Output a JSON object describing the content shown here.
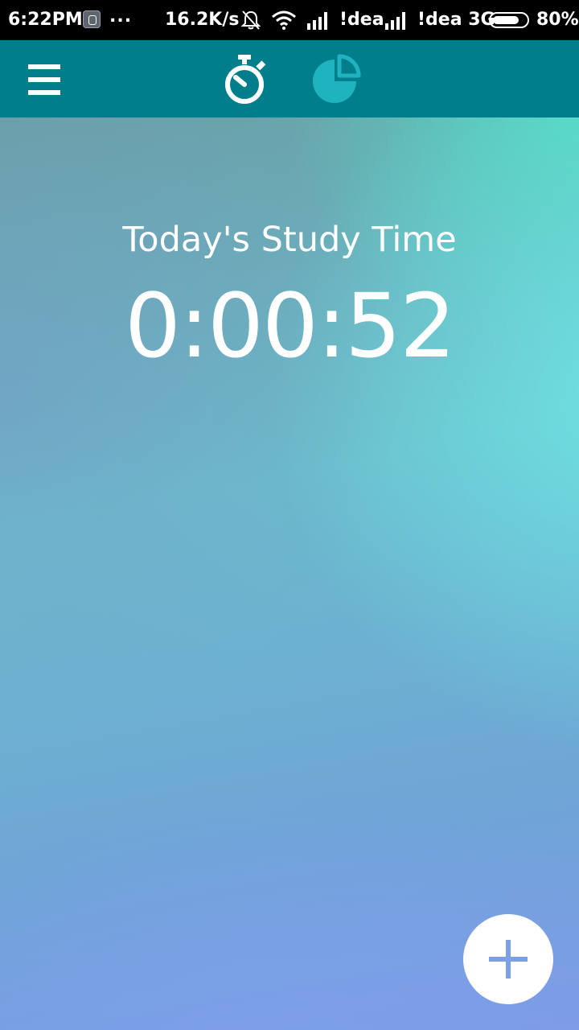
{
  "status_bar": {
    "time": "6:22PM",
    "more": "...",
    "speed": "16.2K/s",
    "carrier_1": "!dea",
    "carrier_2": "!dea 3G",
    "battery_percent": "80%",
    "battery_level": 0.8,
    "icons": [
      "sim-icon",
      "bell-off-icon",
      "wifi-icon",
      "signal-icon",
      "signal-icon",
      "battery-icon"
    ]
  },
  "app_bar": {
    "menu_icon": "hamburger-icon",
    "tabs": [
      {
        "icon": "stopwatch-icon",
        "selected": true
      },
      {
        "icon": "pie-chart-icon",
        "selected": false
      }
    ]
  },
  "main": {
    "title": "Today's Study Time",
    "timer_value": "0:00:52"
  },
  "fab": {
    "icon": "plus-icon"
  },
  "colors": {
    "app_bar": "#017e8c",
    "tab_inactive": "#1fb3bf",
    "fab_icon": "#7d9fe6"
  }
}
